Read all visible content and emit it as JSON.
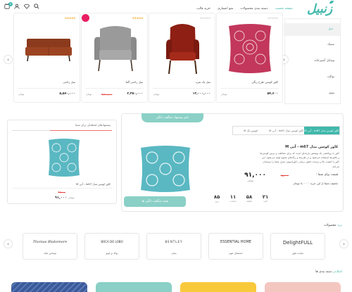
{
  "header": {
    "logo_text": "زنبیل",
    "nav": [
      "صفحه نخست",
      "دسته بندی محصولات",
      "منو انتشاری",
      "خرید قالب"
    ],
    "cart_count": "0"
  },
  "sidebar": {
    "items": [
      "مبل",
      "سینک",
      "وسایل آشپزخانه",
      "توالت",
      "پتوی"
    ]
  },
  "products": [
    {
      "name": "کاور کوسن طرح رنگی",
      "price": "۵۴,۶۰۰",
      "old_price": "",
      "toman": "تومان"
    },
    {
      "name": "مبل تک نفره",
      "price": "۱۲,۰۰۰,۰۰۰",
      "old_price": "",
      "toman": "تومان"
    },
    {
      "name": "مبل راحتی آلفا",
      "price": "۲,۳۵۰,۰۰۰",
      "old_price": "۲,۵۰۰,۰۰۰",
      "toman": "تومان"
    },
    {
      "name": "مبل راحتی",
      "price": "۵,۵۷۰,۰۰۰",
      "old_price": "",
      "toman": "تومان"
    }
  ],
  "offer": {
    "ribbon": "تایم پیشنهاد شگفت انگیز",
    "tabs": [
      "کاور کوسن مدل m67 - آبی M",
      "کاور کوسن مدل m67 - آبی M",
      "کوسن تک M"
    ],
    "title": "کاور کوسن مدل m67 - آبی M",
    "description": "کاور یا روبالشی یک پوشش پارچه‌ای است که برای حفاظت و تزیین کوسن‌ها و بالش‌ها استفاده می‌شود و در طرح‌ها و رنگ‌های متنوع تولید می‌شود. این کاور با کیفیت بالا و دوخت دقیق، زیبایی دکوراسیون منزل شما را دوچندان می‌کند.",
    "price_label": "قیمت برای شما :",
    "old_price": "۹۸,۰۰۰",
    "price": "۹۱,۰۰۰",
    "toman": "تومان",
    "saving": "تخفیف شما از این خرید : ۷,۰۰۰ تومان",
    "countdown": [
      {
        "num": "۸۵",
        "label": "روز"
      },
      {
        "num": "۱۱",
        "label": "ساعت"
      },
      {
        "num": "۵۸",
        "label": "دقیقه"
      },
      {
        "num": "۲۱",
        "label": "ثانیه"
      }
    ],
    "cta": "همه شگفت انگیز ها"
  },
  "side_offer": {
    "title": "پیشنهادهای لحظه‌ای برای شما",
    "name": "کاور کوسن مدل m67 - آبی M",
    "old_price": "۹۸,۰۰۰",
    "price": "۹۱,۰۰۰",
    "toman": "تومان"
  },
  "brands": {
    "title_accent": "برند",
    "title_rest": " محصولات",
    "items": [
      {
        "logo": "DelightFULL",
        "name": "دیلایت فول"
      },
      {
        "logo": "ESSENTIAL HOME",
        "name": "اسنشال هوم"
      },
      {
        "logo": "BENTLEY",
        "name": "بنتلی"
      },
      {
        "logo": "BOCA DO LOBO",
        "name": "بوکا دو لوبو"
      },
      {
        "logo": "Thomas Blakemore",
        "name": "توماس بلیک"
      }
    ]
  },
  "categories": {
    "title_accent": "اسلایدر",
    "title_rest": " دسته بندی ها",
    "colors": [
      "#f4c6c0",
      "#f9c93c",
      "#8ad0c6",
      "#3b5a9a"
    ]
  },
  "colors": {
    "accent": "#3fb8ab",
    "accent_light": "#8ad0c6",
    "sale": "#e53935"
  }
}
